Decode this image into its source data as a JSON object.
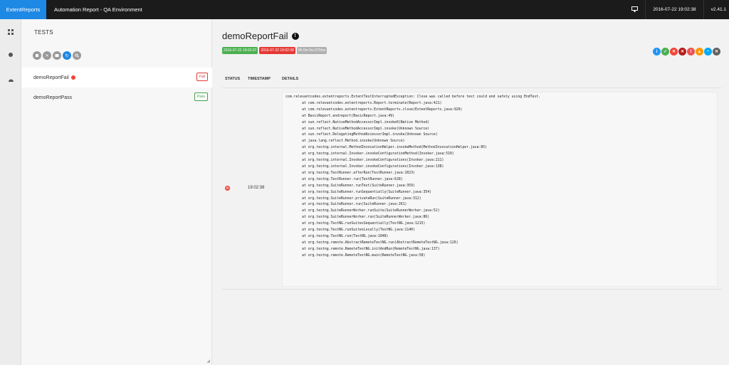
{
  "topbar": {
    "brand": "ExtentReports",
    "report_name": "Automation Report - QA Environment",
    "datetime": "2016-07-22 19:02:38",
    "version": "v2.41.1"
  },
  "sidenav": {
    "icons": [
      "test-view-icon",
      "category-view-icon",
      "dashboard-icon"
    ]
  },
  "tests_panel": {
    "title": "TESTS",
    "filters": [
      "pass-filter",
      "fail-filter",
      "warning-filter",
      "refresh",
      "search"
    ],
    "tests": [
      {
        "name": "demoReportFail",
        "status": "Fail",
        "has_error_dot": true
      },
      {
        "name": "demoReportPass",
        "status": "Pass",
        "has_error_dot": false
      }
    ]
  },
  "test": {
    "name": "demoReportFail",
    "start_time": "2016-07-22 19:02:37",
    "end_time": "2016-07-22 19:02:38",
    "duration": "0h 0m 0s+270ms",
    "columns": [
      "STATUS",
      "TIMESTAMP",
      "DETAILS"
    ],
    "log": {
      "timestamp": "19:02:38",
      "trace": [
        "com.relevantcodes.extentreports.ExtentTestInterruptedException: Close was called before test could end safely using EndTest.",
        "\tat com.relevantcodes.extentreports.Report.terminate(Report.java:421)",
        "\tat com.relevantcodes.extentreports.ExtentReports.close(ExtentReports.java:920)",
        "\tat BasicReport.endreport(BasicReport.java:49)",
        "\tat sun.reflect.NativeMethodAccessorImpl.invoke0(Native Method)",
        "\tat sun.reflect.NativeMethodAccessorImpl.invoke(Unknown Source)",
        "\tat sun.reflect.DelegatingMethodAccessorImpl.invoke(Unknown Source)",
        "\tat java.lang.reflect.Method.invoke(Unknown Source)",
        "\tat org.testng.internal.MethodInvocationHelper.invokeMethod(MethodInvocationHelper.java:85)",
        "\tat org.testng.internal.Invoker.invokeConfigurationMethod(Invoker.java:510)",
        "\tat org.testng.internal.Invoker.invokeConfigurations(Invoker.java:211)",
        "\tat org.testng.internal.Invoker.invokeConfigurations(Invoker.java:138)",
        "\tat org.testng.TestRunner.afterRun(TestRunner.java:1023)",
        "\tat org.testng.TestRunner.run(TestRunner.java:628)",
        "\tat org.testng.SuiteRunner.runTest(SuiteRunner.java:359)",
        "\tat org.testng.SuiteRunner.runSequentially(SuiteRunner.java:354)",
        "\tat org.testng.SuiteRunner.privateRun(SuiteRunner.java:312)",
        "\tat org.testng.SuiteRunner.run(SuiteRunner.java:261)",
        "\tat org.testng.SuiteRunnerWorker.runSuite(SuiteRunnerWorker.java:52)",
        "\tat org.testng.SuiteRunnerWorker.run(SuiteRunnerWorker.java:86)",
        "\tat org.testng.TestNG.runSuitesSequentially(TestNG.java:1215)",
        "\tat org.testng.TestNG.runSuitesLocally(TestNG.java:1140)",
        "\tat org.testng.TestNG.run(TestNG.java:1048)",
        "\tat org.testng.remote.AbstractRemoteTestNG.run(AbstractRemoteTestNG.java:126)",
        "\tat org.testng.remote.RemoteTestNG.initAndRun(RemoteTestNG.java:137)",
        "\tat org.testng.remote.RemoteTestNG.main(RemoteTestNG.java:58)"
      ]
    }
  },
  "status_icons": [
    {
      "name": "info",
      "color": "#2196f3"
    },
    {
      "name": "pass",
      "color": "#4caf50"
    },
    {
      "name": "fail",
      "color": "#f44336"
    },
    {
      "name": "fatal",
      "color": "#b71c1c"
    },
    {
      "name": "error",
      "color": "#ef5350"
    },
    {
      "name": "warning",
      "color": "#ff9800"
    },
    {
      "name": "skip",
      "color": "#03a9f4"
    },
    {
      "name": "unknown",
      "color": "#616161"
    }
  ],
  "colors": {
    "accent": "#1e88e5",
    "pass": "#4caf50",
    "fail": "#e53935",
    "neutral": "#9e9e9e"
  }
}
